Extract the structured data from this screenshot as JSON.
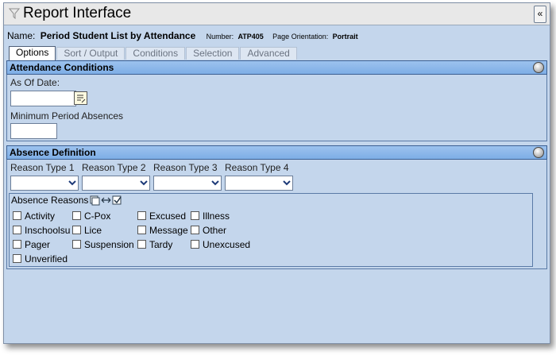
{
  "window": {
    "title": "Report Interface",
    "collapse_label": "«"
  },
  "report": {
    "name_label": "Name:",
    "name_value": "Period Student List by Attendance",
    "number_label": "Number:",
    "number_value": "ATP405",
    "orientation_label": "Page Orientation:",
    "orientation_value": "Portrait"
  },
  "tabs": [
    {
      "label": "Options",
      "active": true
    },
    {
      "label": "Sort / Output",
      "active": false
    },
    {
      "label": "Conditions",
      "active": false
    },
    {
      "label": "Selection",
      "active": false
    },
    {
      "label": "Advanced",
      "active": false
    }
  ],
  "attendance": {
    "header": "Attendance Conditions",
    "as_of_label": "As Of Date:",
    "as_of_value": "",
    "min_absences_label": "Minimum Period Absences",
    "min_absences_value": ""
  },
  "absence": {
    "header": "Absence Definition",
    "reason_types": [
      {
        "label": "Reason Type 1",
        "value": ""
      },
      {
        "label": "Reason Type 2",
        "value": ""
      },
      {
        "label": "Reason Type 3",
        "value": ""
      },
      {
        "label": "Reason Type 4",
        "value": ""
      }
    ],
    "reasons_label": "Absence Reasons",
    "reasons": [
      {
        "label": "Activity",
        "checked": false
      },
      {
        "label": "C-Pox",
        "checked": false
      },
      {
        "label": "Excused",
        "checked": false
      },
      {
        "label": "Illness",
        "checked": false
      },
      {
        "label": "Inschoolsu",
        "checked": false
      },
      {
        "label": "Lice",
        "checked": false
      },
      {
        "label": "Message",
        "checked": false
      },
      {
        "label": "Other",
        "checked": false
      },
      {
        "label": "Pager",
        "checked": false
      },
      {
        "label": "Suspension",
        "checked": false
      },
      {
        "label": "Tardy",
        "checked": false
      },
      {
        "label": "Unexcused",
        "checked": false
      },
      {
        "label": "Unverified",
        "checked": false
      }
    ]
  },
  "colors": {
    "accent_header": "#8db8ea",
    "panel_bg": "#c4d6ec"
  },
  "icons": {
    "title": "filter-funnel-icon",
    "section_toggle": "section-toggle-icon",
    "calendar": "calendar-icon",
    "dropdown": "dropdown-arrow-icon",
    "select_toggle": "select-all-toggle-icon"
  }
}
